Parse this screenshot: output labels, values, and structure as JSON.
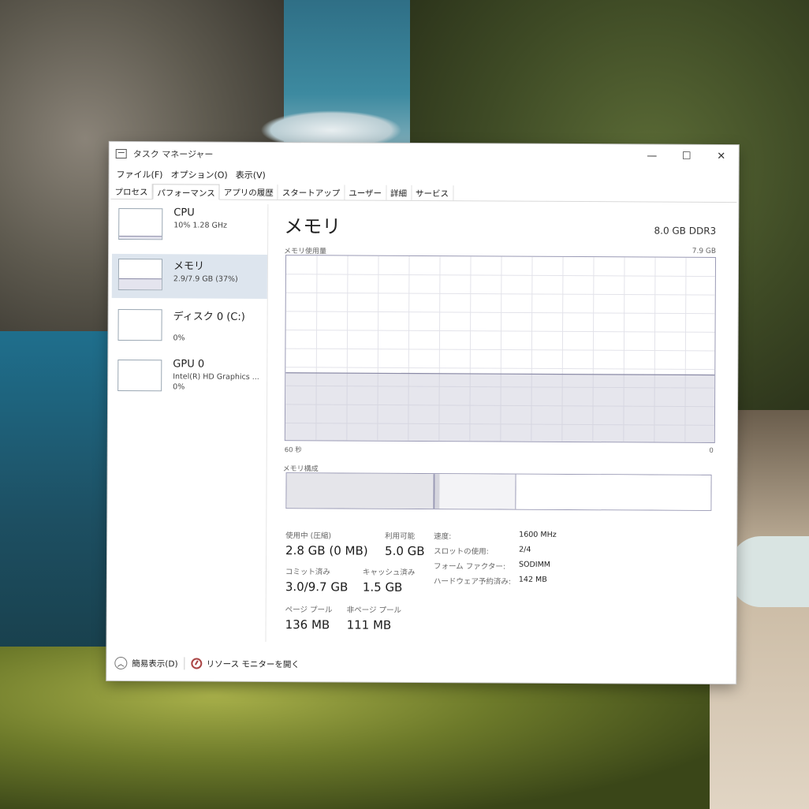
{
  "window": {
    "title": "タスク マネージャー",
    "controls": {
      "minimize": "—",
      "maximize": "☐",
      "close": "✕"
    }
  },
  "menu": [
    "ファイル(F)",
    "オプション(O)",
    "表示(V)"
  ],
  "tabs": [
    "プロセス",
    "パフォーマンス",
    "アプリの履歴",
    "スタートアップ",
    "ユーザー",
    "詳細",
    "サービス"
  ],
  "active_tab": "パフォーマンス",
  "resources": [
    {
      "name": "CPU",
      "line1": "10%  1.28 GHz",
      "line2": "",
      "level": 0.1
    },
    {
      "name": "メモリ",
      "line1": "2.9/7.9 GB (37%)",
      "line2": "",
      "level": 0.37
    },
    {
      "name": "ディスク 0 (C:)",
      "line1": "",
      "line2": "0%",
      "level": 0.0
    },
    {
      "name": "GPU 0",
      "line1": "Intel(R) HD Graphics ...",
      "line2": "0%",
      "level": 0.0
    }
  ],
  "memory": {
    "heading": "メモリ",
    "spec": "8.0 GB DDR3",
    "usage_label": "メモリ使用量",
    "usage_max": "7.9 GB",
    "time_left": "60 秒",
    "time_right": "0",
    "usage_fraction": 0.37,
    "composition_label": "メモリ構成",
    "stats": {
      "in_use_label": "使用中 (圧縮)",
      "in_use_value": "2.8 GB (0 MB)",
      "available_label": "利用可能",
      "available_value": "5.0 GB",
      "committed_label": "コミット済み",
      "committed_value": "3.0/9.7 GB",
      "cached_label": "キャッシュ済み",
      "cached_value": "1.5 GB",
      "paged_label": "ページ プール",
      "paged_value": "136 MB",
      "nonpaged_label": "非ページ プール",
      "nonpaged_value": "111 MB"
    },
    "props": [
      {
        "label": "速度:",
        "value": "1600 MHz"
      },
      {
        "label": "スロットの使用:",
        "value": "2/4"
      },
      {
        "label": "フォーム ファクター:",
        "value": "SODIMM"
      },
      {
        "label": "ハードウェア予約済み:",
        "value": "142 MB"
      }
    ]
  },
  "footer": {
    "fewer_details": "簡易表示(D)",
    "resource_monitor": "リソース モニターを開く"
  }
}
